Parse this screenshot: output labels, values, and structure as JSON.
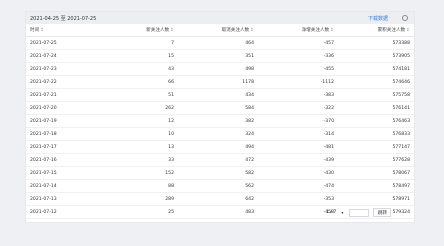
{
  "header": {
    "date_range": "2021-04-25 至 2021-07-25",
    "download_label": "下载数据",
    "settings_icon": "gear-icon"
  },
  "table": {
    "columns": [
      "时间",
      "新关注人数",
      "取消关注人数",
      "净增关注人数",
      "累积关注人数"
    ],
    "rows": [
      [
        "2021-07-25",
        "7",
        "464",
        "-457",
        "573388"
      ],
      [
        "2021-07-24",
        "15",
        "351",
        "-336",
        "573905"
      ],
      [
        "2021-07-23",
        "43",
        "498",
        "-455",
        "574181"
      ],
      [
        "2021-07-22",
        "66",
        "1178",
        "-1112",
        "574646"
      ],
      [
        "2021-07-21",
        "51",
        "434",
        "-383",
        "575758"
      ],
      [
        "2021-07-20",
        "262",
        "584",
        "-322",
        "576141"
      ],
      [
        "2021-07-19",
        "12",
        "382",
        "-370",
        "576463"
      ],
      [
        "2021-07-18",
        "10",
        "324",
        "-314",
        "576833"
      ],
      [
        "2021-07-17",
        "13",
        "494",
        "-481",
        "577147"
      ],
      [
        "2021-07-16",
        "33",
        "472",
        "-439",
        "577628"
      ],
      [
        "2021-07-15",
        "152",
        "582",
        "-430",
        "578067"
      ],
      [
        "2021-07-14",
        "88",
        "562",
        "-474",
        "578497"
      ],
      [
        "2021-07-13",
        "289",
        "642",
        "-353",
        "578971"
      ],
      [
        "2021-07-12",
        "25",
        "483",
        "-458",
        "579324"
      ]
    ]
  },
  "pager": {
    "info": "1 / 7",
    "page_select": "▾",
    "jump_label": "跳转"
  }
}
